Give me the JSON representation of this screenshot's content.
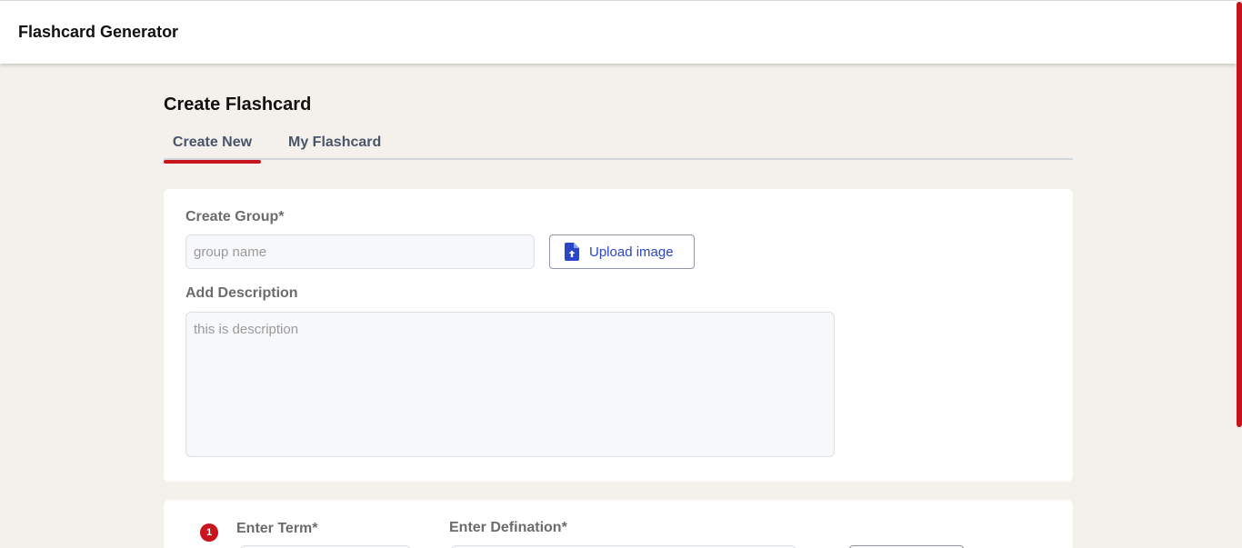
{
  "app": {
    "title": "Flashcard Generator"
  },
  "page": {
    "title": "Create Flashcard"
  },
  "tabs": [
    {
      "label": "Create New",
      "active": true
    },
    {
      "label": "My Flashcard",
      "active": false
    }
  ],
  "group_form": {
    "group_label": "Create Group*",
    "group_placeholder": "group name",
    "upload_label": "Upload image",
    "description_label": "Add Description",
    "description_placeholder": "this is description"
  },
  "term_form": {
    "index": "1",
    "term_label": "Enter Term*",
    "definition_label": "Enter Defination*"
  },
  "colors": {
    "accent": "#c8141c",
    "link": "#2a45c8",
    "background": "#f4f1ec"
  },
  "icons": {
    "upload": "file-upload-icon"
  }
}
